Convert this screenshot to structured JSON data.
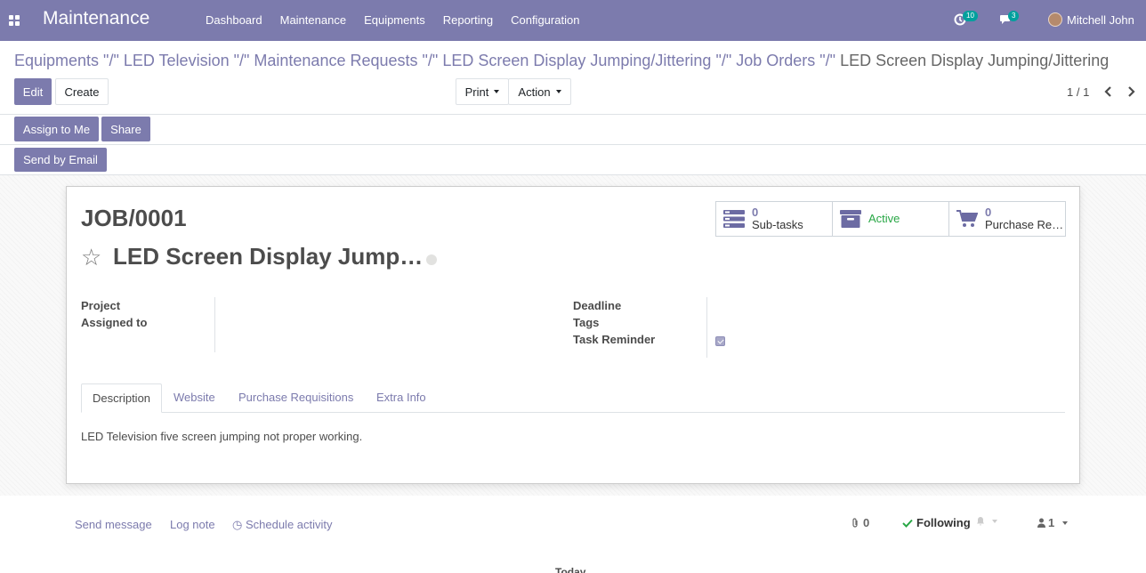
{
  "app": {
    "name": "Maintenance"
  },
  "menu": [
    "Dashboard",
    "Maintenance",
    "Equipments",
    "Reporting",
    "Configuration"
  ],
  "systray": {
    "activity_count": "10",
    "message_count": "3",
    "user_name": "Mitchell John"
  },
  "breadcrumb": {
    "items": [
      "Equipments \"/\"",
      "LED Television \"/\"",
      "Maintenance Requests \"/\"",
      "LED Screen Display Jumping/Jittering \"/\"",
      "Job Orders \"/\""
    ],
    "active": "LED Screen Display Jumping/Jittering"
  },
  "toolbar": {
    "edit_label": "Edit",
    "create_label": "Create",
    "print_label": "Print",
    "action_label": "Action",
    "pager": "1 / 1"
  },
  "header_buttons": {
    "assign_label": "Assign to Me",
    "share_label": "Share",
    "send_email_label": "Send by Email"
  },
  "record": {
    "job_number": "JOB/0001",
    "name": "LED Screen Display Jump…",
    "stats": {
      "subtasks_value": "0",
      "subtasks_label": "Sub-tasks",
      "active_label": "Active",
      "purchase_value": "0",
      "purchase_label": "Purchase Re…"
    },
    "fields": {
      "project": "Project",
      "assigned_to": "Assigned to",
      "deadline": "Deadline",
      "tags": "Tags",
      "task_reminder": "Task Reminder"
    },
    "tabs": [
      "Description",
      "Website",
      "Purchase Requisitions",
      "Extra Info"
    ],
    "description": "LED Television five screen jumping not proper working."
  },
  "chatter": {
    "send_message": "Send message",
    "log_note": "Log note",
    "schedule_activity": "Schedule activity",
    "attachments": "0",
    "following": "Following",
    "followers": "1",
    "today": "Today"
  },
  "colors": {
    "brand": "#7c7bad",
    "active_status": "#28a745",
    "badge": "#00a09d"
  },
  "icons": [
    "apps-icon",
    "activity-clock-icon",
    "messages-icon",
    "avatar",
    "chevron-left-icon",
    "chevron-right-icon",
    "tasks-icon",
    "archive-icon",
    "cart-icon",
    "star-icon",
    "paperclip-icon",
    "check-icon",
    "bell-icon",
    "user-icon",
    "clock-icon"
  ]
}
